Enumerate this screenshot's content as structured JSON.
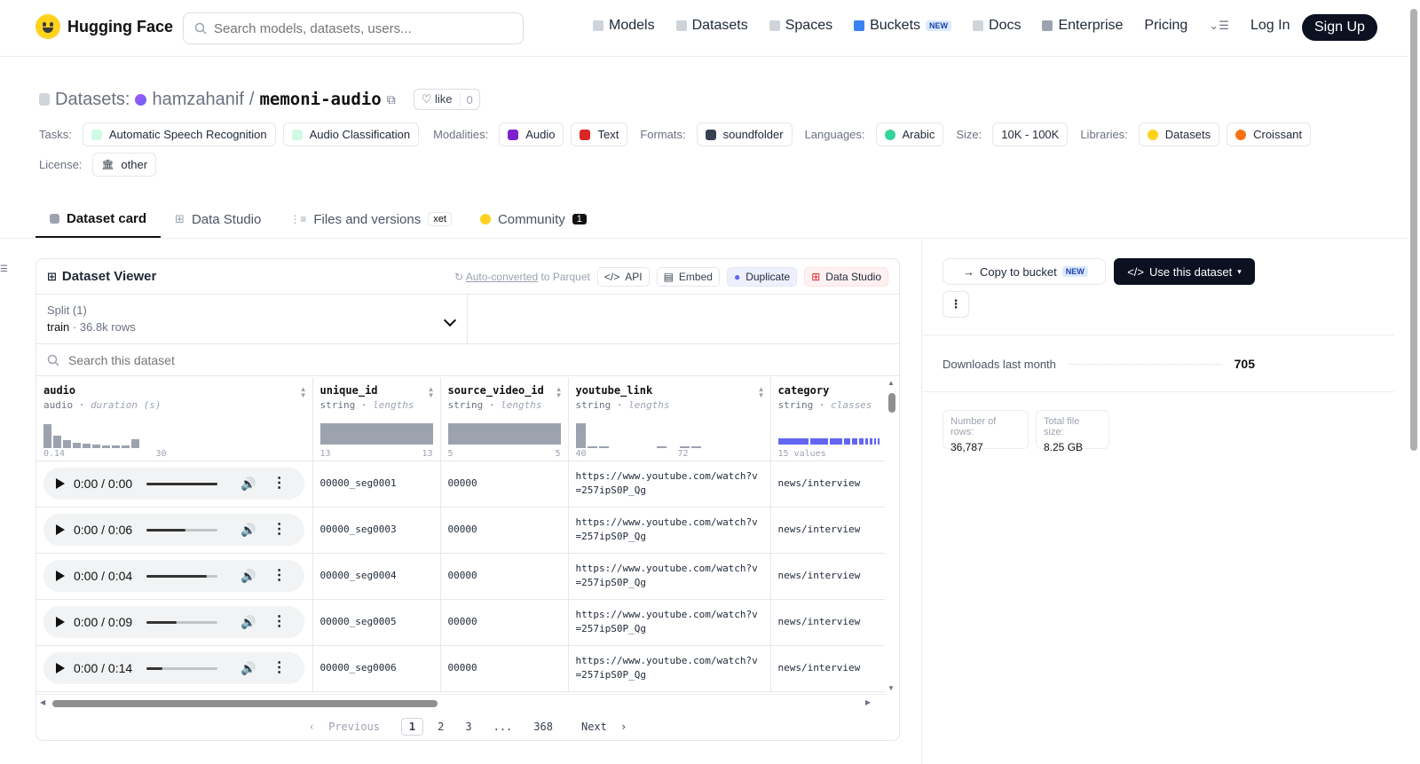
{
  "header": {
    "brand": "Hugging Face",
    "search_placeholder": "Search models, datasets, users...",
    "nav": [
      {
        "label": "Models",
        "icon": "cube-icon"
      },
      {
        "label": "Datasets",
        "icon": "database-icon"
      },
      {
        "label": "Spaces",
        "icon": "grid-icon"
      },
      {
        "label": "Buckets",
        "icon": "bucket-icon",
        "badge": "NEW"
      },
      {
        "label": "Docs",
        "icon": "book-icon"
      },
      {
        "label": "Enterprise",
        "icon": "briefcase-icon"
      },
      {
        "label": "Pricing",
        "icon": ""
      }
    ],
    "login": "Log In",
    "signup": "Sign Up"
  },
  "dataset": {
    "prefix": "Datasets:",
    "owner": "hamzahanif",
    "separator": "/",
    "name": "memoni-audio",
    "like_label": "like",
    "like_count": "0"
  },
  "tags": {
    "tasks_label": "Tasks:",
    "tasks": [
      "Automatic Speech Recognition",
      "Audio Classification"
    ],
    "modalities_label": "Modalities:",
    "modalities": [
      "Audio",
      "Text"
    ],
    "formats_label": "Formats:",
    "formats": [
      "soundfolder"
    ],
    "languages_label": "Languages:",
    "languages": [
      "Arabic"
    ],
    "size_label": "Size:",
    "size": [
      "10K - 100K"
    ],
    "libraries_label": "Libraries:",
    "libraries": [
      "Datasets",
      "Croissant"
    ],
    "license_label": "License:",
    "license": [
      "other"
    ]
  },
  "tabs": [
    {
      "label": "Dataset card",
      "active": true
    },
    {
      "label": "Data Studio"
    },
    {
      "label": "Files and versions",
      "badge": "xet"
    },
    {
      "label": "Community",
      "badge": "1"
    }
  ],
  "viewer": {
    "title": "Dataset Viewer",
    "auto_converted": "Auto-converted",
    "to_parquet": " to Parquet",
    "api": "API",
    "embed": "Embed",
    "duplicate": "Duplicate",
    "data_studio": "Data Studio",
    "split_label": "Split (1)",
    "split_name": "train",
    "split_dot": "·",
    "split_rows": "36.8k rows",
    "search_placeholder": "Search this dataset",
    "columns": [
      {
        "name": "audio",
        "type": "audio",
        "stat": "duration (s)",
        "min": "0.14",
        "max": "30"
      },
      {
        "name": "unique_id",
        "type": "string",
        "stat": "lengths",
        "min": "13",
        "max": "13"
      },
      {
        "name": "source_video_id",
        "type": "string",
        "stat": "lengths",
        "min": "5",
        "max": "5"
      },
      {
        "name": "youtube_link",
        "type": "string",
        "stat": "lengths",
        "min": "40",
        "max": "72"
      },
      {
        "name": "category",
        "type": "string",
        "stat": "classes",
        "min": "15 values",
        "max": ""
      }
    ],
    "audio_histogram": [
      0.95,
      0.5,
      0.3,
      0.2,
      0.15,
      0.12,
      0.1,
      0.1,
      0.1,
      0.35
    ],
    "link_histogram": [
      1.0,
      0.05,
      0.05,
      0.0,
      0.0,
      0.0,
      0.0,
      0.05,
      0.0,
      0.05,
      0.05
    ],
    "rows": [
      {
        "time": "0:00 / 0:00",
        "progress": 1.0,
        "unique_id": "00000_seg0001",
        "source_video_id": "00000",
        "youtube_link": "https://www.youtube.com/watch?v=257ipS0P_Qg",
        "category": "news/interview"
      },
      {
        "time": "0:00 / 0:06",
        "progress": 0.55,
        "unique_id": "00000_seg0003",
        "source_video_id": "00000",
        "youtube_link": "https://www.youtube.com/watch?v=257ipS0P_Qg",
        "category": "news/interview"
      },
      {
        "time": "0:00 / 0:04",
        "progress": 0.85,
        "unique_id": "00000_seg0004",
        "source_video_id": "00000",
        "youtube_link": "https://www.youtube.com/watch?v=257ipS0P_Qg",
        "category": "news/interview"
      },
      {
        "time": "0:00 / 0:09",
        "progress": 0.42,
        "unique_id": "00000_seg0005",
        "source_video_id": "00000",
        "youtube_link": "https://www.youtube.com/watch?v=257ipS0P_Qg",
        "category": "news/interview"
      },
      {
        "time": "0:00 / 0:14",
        "progress": 0.22,
        "unique_id": "00000_seg0006",
        "source_video_id": "00000",
        "youtube_link": "https://www.youtube.com/watch?v=257ipS0P_Qg",
        "category": "news/interview"
      }
    ],
    "pager": {
      "prev": "Previous",
      "pages": [
        "1",
        "2",
        "3",
        "...",
        "368"
      ],
      "next": "Next"
    }
  },
  "sidebar": {
    "copy_bucket": "Copy to bucket",
    "copy_badge": "NEW",
    "use_dataset": "Use this dataset",
    "downloads_label": "Downloads last month",
    "downloads_value": "705",
    "rows_label": "Number of rows:",
    "rows_value": "36,787",
    "size_label": "Total file size:",
    "size_value": "8.25 GB"
  },
  "colors": {
    "accent": "#6366f1",
    "primary_dark": "#0b1120",
    "brand_yellow": "#ffd21e"
  }
}
